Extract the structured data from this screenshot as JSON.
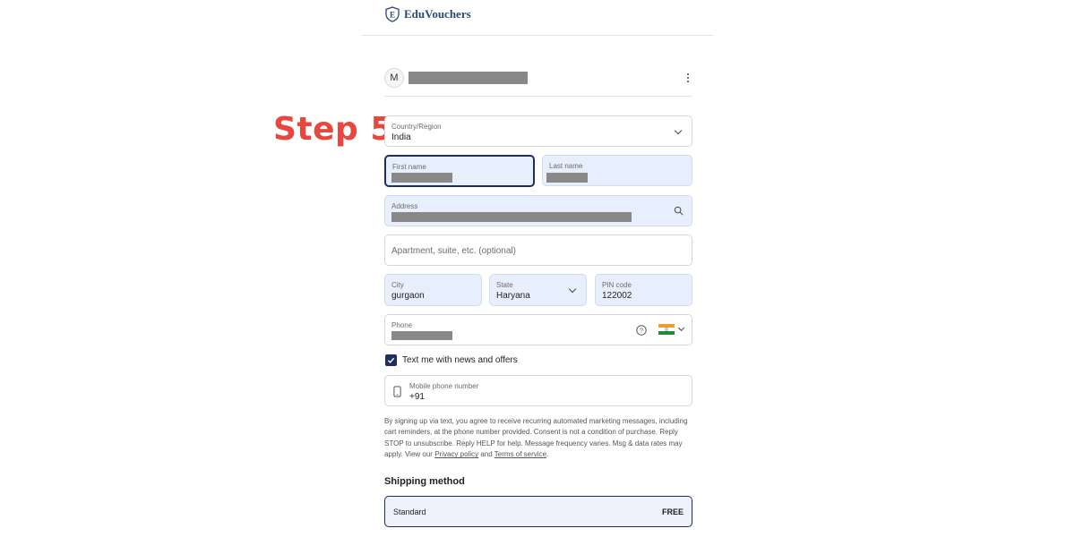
{
  "annotation": {
    "step_label": "Step 5"
  },
  "header": {
    "brand": "EduVouchers",
    "logo_icon": "shield-e-icon"
  },
  "account": {
    "avatar_initial": "M",
    "menu_icon": "kebab-menu-icon"
  },
  "form": {
    "country": {
      "label": "Country/Region",
      "value": "India"
    },
    "first_name": {
      "label": "First name"
    },
    "last_name": {
      "label": "Last name"
    },
    "address": {
      "label": "Address",
      "icon": "search-icon"
    },
    "apartment": {
      "placeholder": "Apartment, suite, etc. (optional)"
    },
    "city": {
      "label": "City",
      "value": "gurgaon"
    },
    "state": {
      "label": "State",
      "value": "Haryana"
    },
    "pin": {
      "label": "PIN code",
      "value": "122002"
    },
    "phone": {
      "label": "Phone",
      "help_icon": "question-circle-icon",
      "flag_icon": "india-flag-icon"
    },
    "sms_optin": {
      "label": "Text me with news and offers",
      "checked": true
    },
    "mobile": {
      "label": "Mobile phone number",
      "value": "+91",
      "icon": "mobile-phone-icon"
    }
  },
  "disclaimer": {
    "text": "By signing up via text, you agree to receive recurring automated marketing messages, including cart reminders, at the phone number provided. Consent is not a condition of purchase. Reply STOP to unsubscribe. Reply HELP for help. Message frequency varies. Msg & data rates may apply. View our",
    "privacy_link": "Privacy policy",
    "and": "and",
    "terms_link": "Terms of service",
    "end": "."
  },
  "shipping": {
    "title": "Shipping method",
    "option_name": "Standard",
    "option_price": "FREE"
  },
  "colors": {
    "accent": "#1c2f5f",
    "step_red": "#e8473f",
    "filled_bg": "#e8effc",
    "redaction": "#888888"
  }
}
